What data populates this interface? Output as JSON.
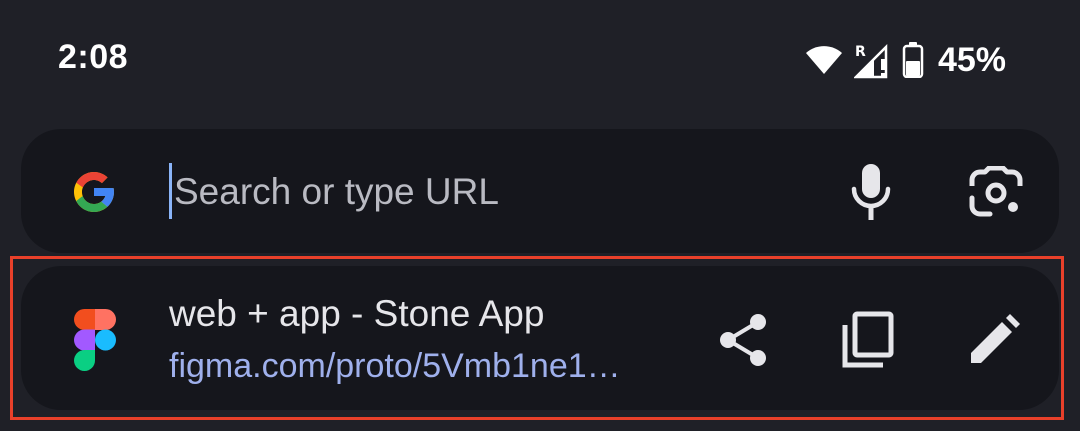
{
  "status_bar": {
    "time": "2:08",
    "roaming_indicator": "R",
    "battery_percent": "45%",
    "icons": [
      "wifi-icon",
      "signal-icon",
      "battery-icon"
    ]
  },
  "search": {
    "placeholder": "Search or type URL",
    "value": "",
    "leading_icon": "google-g-icon",
    "actions": [
      "microphone-icon",
      "lens-camera-icon"
    ]
  },
  "suggestion": {
    "title": "web + app - Stone App",
    "url": "figma.com/proto/5Vmb1ne1…",
    "site_icon": "figma-icon",
    "actions": [
      "share-icon",
      "copy-icon",
      "edit-icon"
    ]
  },
  "colors": {
    "background": "#1f2027",
    "surface": "#15161c",
    "url_text": "#9fb0ec",
    "highlight": "#e8402a",
    "caret": "#8ab4f8"
  }
}
